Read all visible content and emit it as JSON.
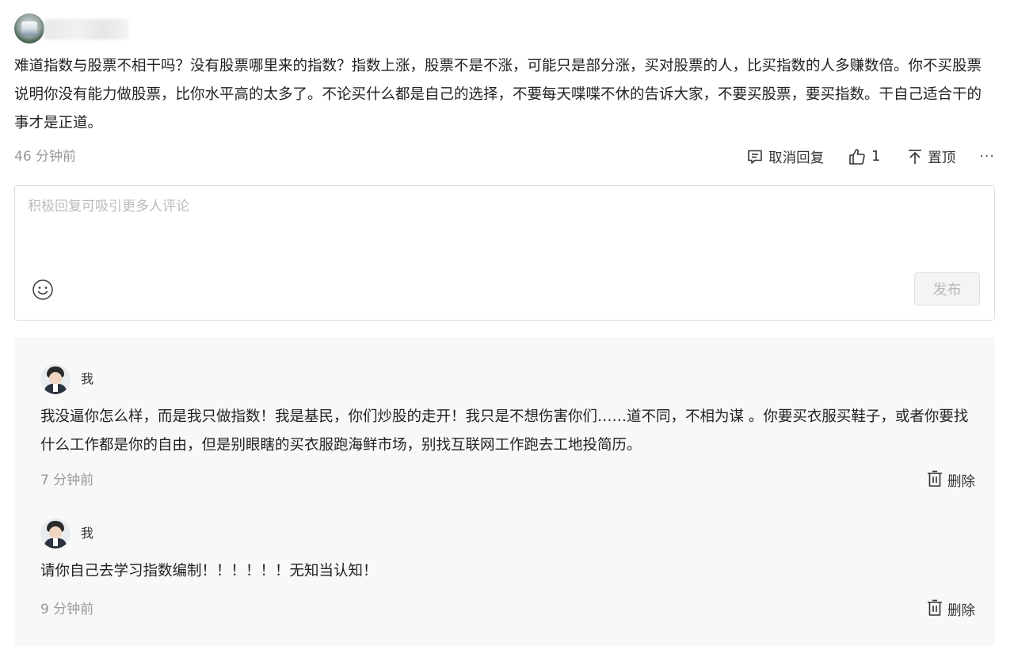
{
  "comment": {
    "text": "难道指数与股票不相干吗？没有股票哪里来的指数？指数上涨，股票不是不涨，可能只是部分涨，买对股票的人，比买指数的人多赚数倍。你不买股票说明你没有能力做股票，比你水平高的太多了。不论买什么都是自己的选择，不要每天喋喋不休的告诉大家，不要买股票，要买指数。干自己适合干的事才是正道。",
    "time": "46 分钟前",
    "actions": {
      "cancel_reply": "取消回复",
      "like_count": "1",
      "pin": "置顶",
      "more": "···"
    }
  },
  "reply_box": {
    "placeholder": "积极回复可吸引更多人评论",
    "value": "",
    "publish_label": "发布"
  },
  "replies": [
    {
      "author": "我",
      "text": "我没逼你怎么样，而是我只做指数！我是基民，你们炒股的走开！我只是不想伤害你们……道不同，不相为谋 。你要买衣服买鞋子，或者你要找什么工作都是你的自由，但是别眼瞎的买衣服跑海鲜市场，别找互联网工作跑去工地投简历。",
      "time": "7 分钟前",
      "delete_label": "删除"
    },
    {
      "author": "我",
      "text": "请你自己去学习指数编制！！！！！！无知当认知！",
      "time": "9 分钟前",
      "delete_label": "删除"
    }
  ],
  "colors": {
    "text": "#222222",
    "muted": "#999999",
    "reply_bg": "#f8f8f8",
    "border": "#dddddd"
  }
}
